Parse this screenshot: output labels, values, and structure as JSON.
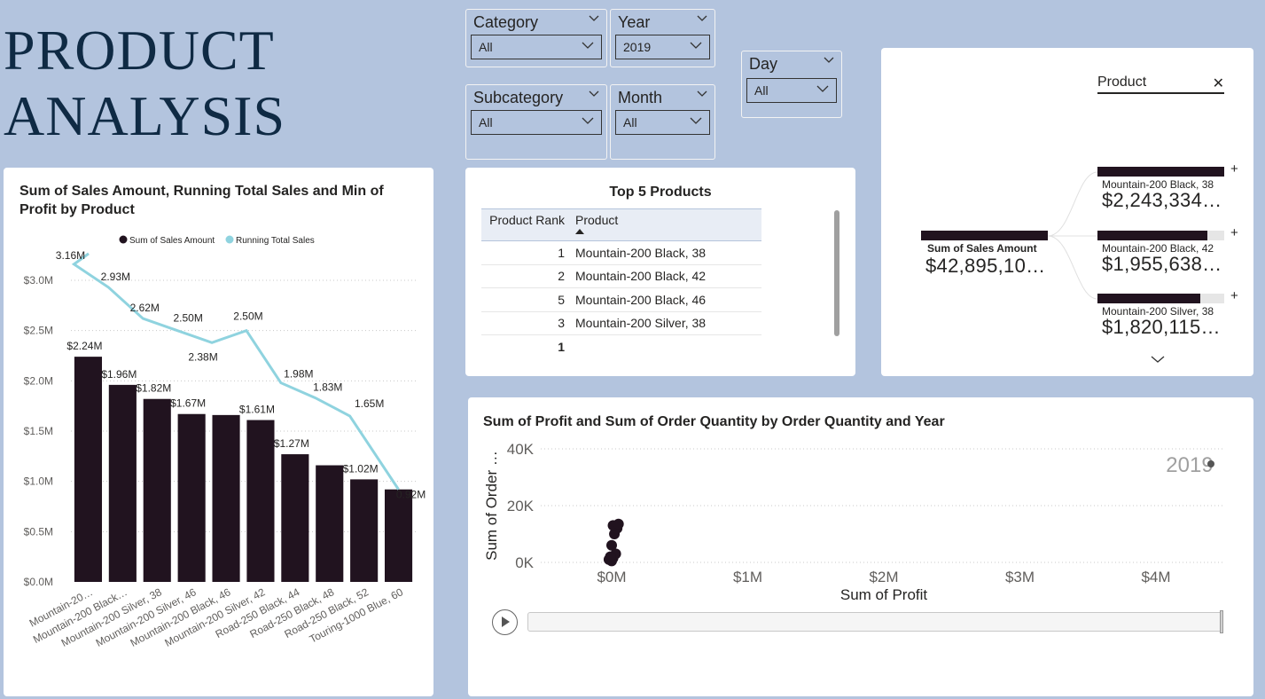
{
  "page_title": [
    "PRODUCT",
    "ANALYSIS"
  ],
  "colors": {
    "background": "#b3c4de",
    "bar": "#21131f",
    "running_total_line": "#8fd3df",
    "title": "#0f2a44"
  },
  "slicers": {
    "category": {
      "label": "Category",
      "value": "All"
    },
    "year": {
      "label": "Year",
      "value": "2019"
    },
    "subcategory": {
      "label": "Subcategory",
      "value": "All"
    },
    "month": {
      "label": "Month",
      "value": "All"
    },
    "day": {
      "label": "Day",
      "value": "All"
    }
  },
  "top5": {
    "title": "Top 5 Products",
    "headers": {
      "rank": "Product Rank",
      "product": "Product"
    },
    "rows": [
      {
        "rank": "1",
        "product": "Mountain-200 Black, 38"
      },
      {
        "rank": "2",
        "product": "Mountain-200 Black, 42"
      },
      {
        "rank": "5",
        "product": "Mountain-200 Black, 46"
      },
      {
        "rank": "3",
        "product": "Mountain-200 Silver, 38"
      }
    ],
    "total": "1"
  },
  "decomp": {
    "filter_label": "Product",
    "close_icon": "close-icon",
    "root": {
      "label": "Sum of Sales Amount",
      "value": "$42,895,10…"
    },
    "children": [
      {
        "label": "Mountain-200 Black, 38",
        "value": "$2,243,334…",
        "fraction": 1.0
      },
      {
        "label": "Mountain-200 Black, 42",
        "value": "$1,955,638…",
        "fraction": 0.87
      },
      {
        "label": "Mountain-200 Silver, 38",
        "value": "$1,820,115…",
        "fraction": 0.81
      }
    ],
    "plus": "+"
  },
  "chart_data": [
    {
      "type": "bar+line",
      "title": "Sum of Sales Amount, Running Total Sales and Min of Profit by Product",
      "legend": [
        "Sum of Sales Amount",
        "Running Total Sales"
      ],
      "legend_position": "top-center",
      "categories": [
        "Mountain-20…",
        "Mountain-200 Black…",
        "Mountain-200 Silver, 38",
        "Mountain-200 Silver, 46",
        "Mountain-200 Black, 46",
        "Mountain-200 Silver, 42",
        "Road-250 Black, 44",
        "Road-250 Black, 48",
        "Road-250 Black, 52",
        "Touring-1000 Blue, 60"
      ],
      "series": [
        {
          "name": "Sum of Sales Amount",
          "values": [
            2.24,
            1.96,
            1.82,
            1.67,
            1.66,
            1.61,
            1.27,
            1.16,
            1.02,
            0.92
          ],
          "labels": [
            "$2.24M",
            "$1.96M",
            "$1.82M",
            "$1.67M",
            "",
            "$1.61M",
            "$1.27M",
            "",
            "$1.02M",
            ""
          ]
        },
        {
          "name": "Running Total Sales",
          "values": [
            3.16,
            2.93,
            2.62,
            2.5,
            2.38,
            2.5,
            1.98,
            1.83,
            1.65,
            0.92
          ],
          "labels": [
            "3.16M",
            "2.93M",
            "2.62M",
            "2.50M",
            "2.38M",
            "2.50M",
            "1.98M",
            "1.83M",
            "1.65M",
            "0.92M"
          ]
        }
      ],
      "y_ticks": [
        "$0.0M",
        "$0.5M",
        "$1.0M",
        "$1.5M",
        "$2.0M",
        "$2.5M",
        "$3.0M"
      ],
      "ylim": [
        0,
        3.0
      ],
      "grid": true
    },
    {
      "type": "scatter",
      "title": "Sum of Profit and Sum of Order Quantity by Order Quantity and Year",
      "xlabel": "Sum of Profit",
      "ylabel": "Sum of Order …",
      "x_ticks": [
        "$0M",
        "$1M",
        "$2M",
        "$3M",
        "$4M"
      ],
      "y_ticks": [
        "0K",
        "20K",
        "40K"
      ],
      "xlim": [
        0,
        4
      ],
      "ylim": [
        0,
        40
      ],
      "play_axis_value": "2019",
      "points": [
        {
          "x": 0.0,
          "y": 0.5
        },
        {
          "x": 0.01,
          "y": 1.5
        },
        {
          "x": -0.02,
          "y": 1.0
        },
        {
          "x": 0.03,
          "y": 3.0
        },
        {
          "x": 0.0,
          "y": 6.0
        },
        {
          "x": 0.02,
          "y": 10.0
        },
        {
          "x": 0.04,
          "y": 12.0
        },
        {
          "x": 0.01,
          "y": 13.0
        },
        {
          "x": 0.05,
          "y": 13.5
        },
        {
          "x": -0.01,
          "y": 2.0
        }
      ]
    }
  ]
}
